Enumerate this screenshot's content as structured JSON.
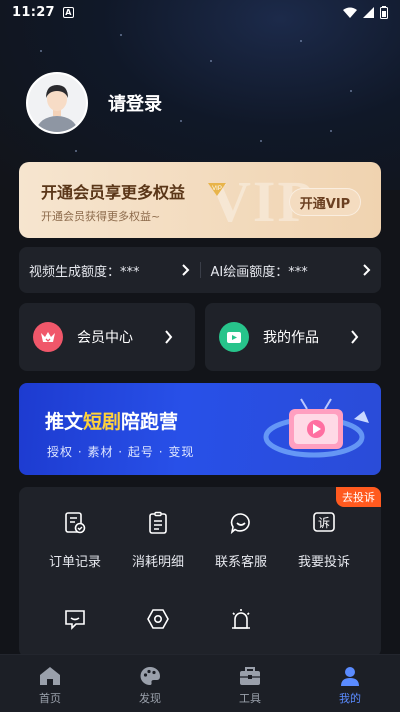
{
  "status_bar": {
    "time": "11:27",
    "notification_letter": "A"
  },
  "profile": {
    "login_label": "请登录"
  },
  "vip_card": {
    "title": "开通会员享更多权益",
    "subtitle": "开通会员获得更多权益~",
    "button_label": "开通VIP",
    "watermark": "VIP",
    "badge_text": "VIP"
  },
  "quota": {
    "video_label": "视频生成额度：***",
    "ai_label": "AI绘画额度：***"
  },
  "tiles": {
    "member_center": "会员中心",
    "my_works": "我的作品"
  },
  "banner": {
    "title_part1": "推文",
    "title_highlight": "短剧",
    "title_part2": "陪跑营",
    "subtitle": "授权 · 素材 · 起号 · 变现"
  },
  "menu": {
    "complaint_badge": "去投诉",
    "items": [
      {
        "label": "订单记录",
        "icon": "order-record-icon"
      },
      {
        "label": "消耗明细",
        "icon": "consumption-detail-icon"
      },
      {
        "label": "联系客服",
        "icon": "customer-service-icon"
      },
      {
        "label": "我要投诉",
        "icon": "complaint-icon",
        "glyph": "诉"
      },
      {
        "label": "",
        "icon": "message-icon"
      },
      {
        "label": "",
        "icon": "settings-icon"
      },
      {
        "label": "",
        "icon": "bell-icon"
      }
    ]
  },
  "tabbar": {
    "items": [
      {
        "label": "首页",
        "icon": "home-icon"
      },
      {
        "label": "发现",
        "icon": "palette-icon"
      },
      {
        "label": "工具",
        "icon": "toolbox-icon"
      },
      {
        "label": "我的",
        "icon": "person-icon",
        "active": true
      }
    ],
    "active_color": "#5a8bff"
  },
  "colors": {
    "background": "#121419",
    "card": "#1f2229",
    "vip_gold": "#f0d3b0",
    "banner_blue": "#2850e8",
    "badge_orange": "#ff5a1f"
  }
}
